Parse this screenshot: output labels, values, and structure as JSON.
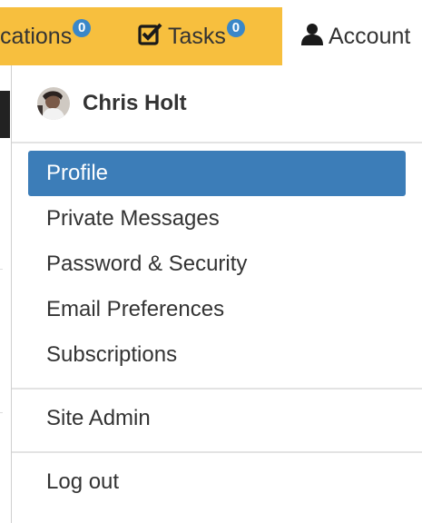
{
  "nav": {
    "notifications": {
      "label": "cations",
      "count": "0"
    },
    "tasks": {
      "label": "Tasks",
      "count": "0"
    },
    "account": {
      "label": "Account"
    }
  },
  "user": {
    "name": "Chris Holt"
  },
  "menu": {
    "items": [
      {
        "label": "Profile",
        "active": true
      },
      {
        "label": "Private Messages"
      },
      {
        "label": "Password & Security"
      },
      {
        "label": "Email Preferences"
      },
      {
        "label": "Subscriptions"
      }
    ],
    "admin": {
      "label": "Site Admin"
    },
    "logout": {
      "label": "Log out"
    }
  },
  "colors": {
    "navbar": "#f7bf3e",
    "badge": "#3a87c8",
    "active_item": "#3c7db8"
  }
}
